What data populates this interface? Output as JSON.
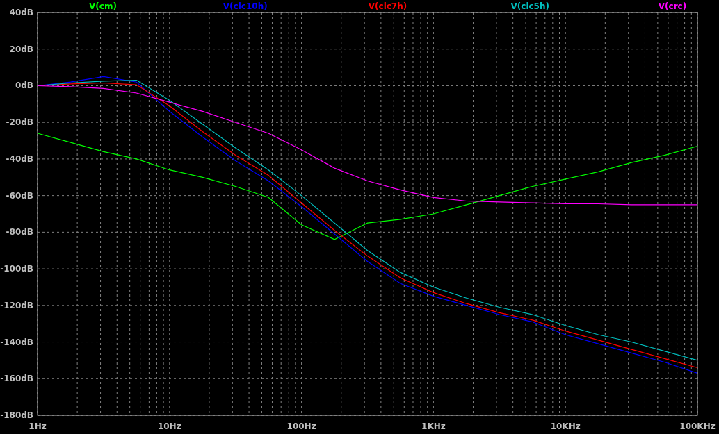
{
  "chart_data": {
    "type": "line",
    "grid": true,
    "categories": [
      "1Hz",
      null,
      null,
      null,
      "10Hz",
      null,
      null,
      null,
      "100Hz",
      null,
      null,
      null,
      "1KHz",
      null,
      null,
      null,
      "10KHz",
      null,
      null,
      null,
      "100KHz"
    ],
    "series": [
      {
        "name": "V(cm)",
        "color": "#00ff00",
        "values": [
          -26,
          -31,
          -36,
          -40,
          -46,
          -50,
          -55,
          -61,
          -76,
          -84,
          -75,
          -73,
          -70,
          -65,
          -60,
          -55,
          -51,
          -47,
          -42,
          -38,
          -33
        ]
      },
      {
        "name": "V(clc10h)",
        "color": "#0000ff",
        "values": [
          0,
          2,
          5,
          2,
          -14,
          -28,
          -41,
          -52,
          -66,
          -81,
          -96,
          -108,
          -115,
          -120,
          -125,
          -129,
          -136,
          -141,
          -146,
          -151,
          -157
        ]
      },
      {
        "name": "V(clc7h)",
        "color": "#ff0000",
        "values": [
          0,
          1,
          1.5,
          0.5,
          -11,
          -25,
          -38,
          -49,
          -64,
          -79,
          -93,
          -105,
          -113,
          -119,
          -124,
          -128,
          -134,
          -139,
          -144,
          -149,
          -154
        ]
      },
      {
        "name": "V(clc5h)",
        "color": "#00c0c0",
        "values": [
          0,
          1.5,
          2.5,
          3,
          -8,
          -21,
          -34,
          -46,
          -60,
          -75,
          -90,
          -102,
          -110,
          -116,
          -121,
          -125,
          -131,
          -136,
          -140,
          -145,
          -150
        ]
      },
      {
        "name": "V(crc)",
        "color": "#ff00ff",
        "values": [
          0,
          -0.5,
          -1.5,
          -4,
          -9,
          -14,
          -20,
          -26,
          -35,
          -45,
          -52,
          -57,
          -61,
          -63,
          -63.5,
          -64,
          -64.5,
          -64.5,
          -65,
          -65,
          -65
        ]
      }
    ],
    "ylim": [
      -180,
      40
    ],
    "yticks": [
      {
        "value": 40,
        "label": "40dB"
      },
      {
        "value": 20,
        "label": "20dB"
      },
      {
        "value": 0,
        "label": "0dB"
      },
      {
        "value": -20,
        "label": "-20dB"
      },
      {
        "value": -40,
        "label": "-40dB"
      },
      {
        "value": -60,
        "label": "-60dB"
      },
      {
        "value": -80,
        "label": "-80dB"
      },
      {
        "value": -100,
        "label": "-100dB"
      },
      {
        "value": -120,
        "label": "-120dB"
      },
      {
        "value": -140,
        "label": "-140dB"
      },
      {
        "value": -160,
        "label": "-160dB"
      },
      {
        "value": -180,
        "label": "-180dB"
      }
    ]
  }
}
